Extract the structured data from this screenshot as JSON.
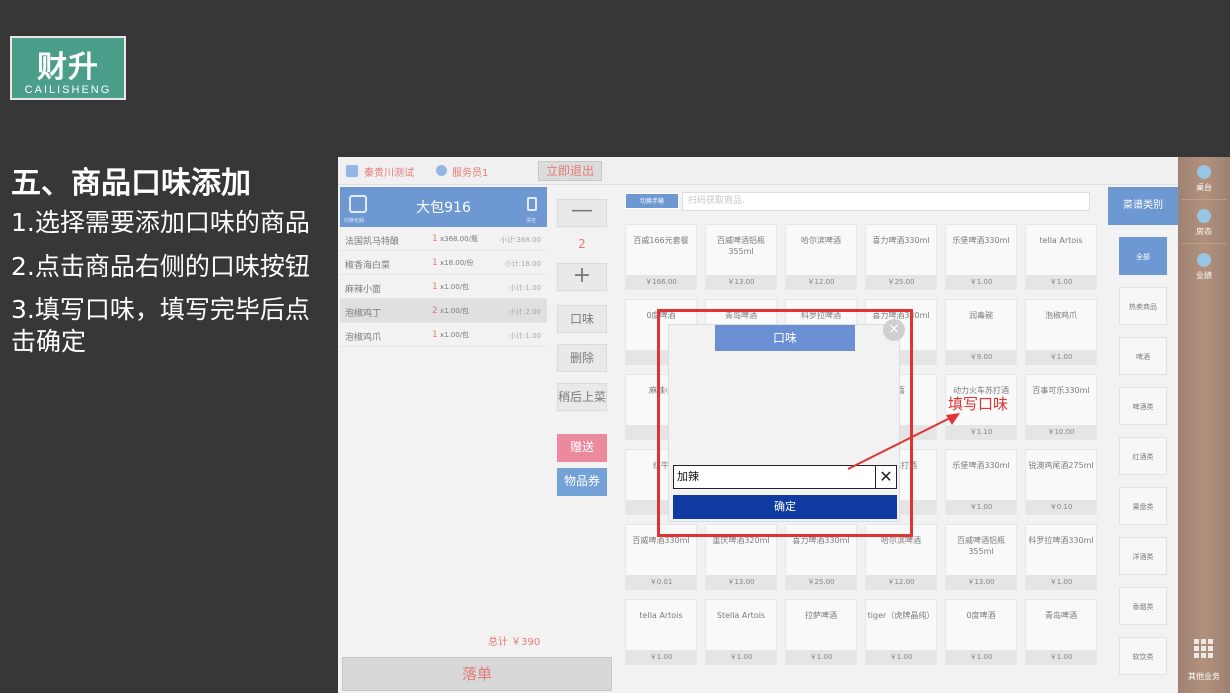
{
  "slide": {
    "logo_main": "财升",
    "logo_sub": "CAILISHENG",
    "title": "五、商品口味添加",
    "steps": [
      "1.选择需要添加口味的商品",
      "2.点击商品右侧的口味按钮",
      "3.填写口味，填写完毕后点击确定"
    ]
  },
  "pos": {
    "topbar": {
      "store": "秦贵川测试",
      "waiter": "服务员1",
      "logout": "立即退出"
    },
    "order": {
      "table": "大包916",
      "left_icon_label": "切换包厢",
      "right_icon_label": "清空",
      "items": [
        {
          "name": "法国凯马特酿",
          "qty": "1",
          "unit": "x368.00/瓶",
          "subtotal": "小计:368.00"
        },
        {
          "name": "椒香海白菜",
          "qty": "1",
          "unit": "x18.00/份",
          "subtotal": "小计:18.00"
        },
        {
          "name": "麻辣小面",
          "qty": "1",
          "unit": "x1.00/包",
          "subtotal": "小计:1.00"
        },
        {
          "name": "泡椒鸡丁",
          "qty": "2",
          "unit": "x1.00/包",
          "subtotal": "小计:2.00"
        },
        {
          "name": "泡椒鸡爪",
          "qty": "1",
          "unit": "x1.00/包",
          "subtotal": "小计:1.00"
        }
      ],
      "total": "总计 ￥390",
      "submit": "落单"
    },
    "actions": {
      "minus": "—",
      "qty": "2",
      "plus": "+",
      "taste": "口味",
      "delete": "删除",
      "later": "稍后上菜",
      "gift": "赠送",
      "voucher": "物品券"
    },
    "search": {
      "scan": "切换手输",
      "placeholder": "扫码获取商品."
    },
    "products": [
      {
        "name": "百威166元套餐",
        "price": "￥166.00"
      },
      {
        "name": "百威啤酒铝瓶355ml",
        "price": "￥13.00"
      },
      {
        "name": "哈尔滨啤酒",
        "price": "￥12.00"
      },
      {
        "name": "喜力啤酒330ml",
        "price": "￥25.00"
      },
      {
        "name": "乐堡啤酒330ml",
        "price": "￥1.00"
      },
      {
        "name": "tella Artois",
        "price": "￥1.00"
      },
      {
        "name": "0度啤酒",
        "price": ""
      },
      {
        "name": "青岛啤酒",
        "price": ""
      },
      {
        "name": "科罗拉啤酒",
        "price": ""
      },
      {
        "name": "喜力啤酒330ml",
        "price": ""
      },
      {
        "name": "润毒碗",
        "price": "￥9.00"
      },
      {
        "name": "泡椒鸡爪",
        "price": "￥1.00"
      },
      {
        "name": "麻辣小",
        "price": ""
      },
      {
        "name": "",
        "price": ""
      },
      {
        "name": "",
        "price": ""
      },
      {
        "name": "喜",
        "price": ""
      },
      {
        "name": "动力火车苏打酒",
        "price": "￥1.10"
      },
      {
        "name": "百事可乐330ml",
        "price": "￥10.00"
      },
      {
        "name": "红牛",
        "price": ""
      },
      {
        "name": "",
        "price": ""
      },
      {
        "name": "",
        "price": ""
      },
      {
        "name": "车苏打酒",
        "price": ""
      },
      {
        "name": "乐堡啤酒330ml",
        "price": "￥1.00"
      },
      {
        "name": "锐澳鸡尾酒275ml",
        "price": "￥0.10"
      },
      {
        "name": "百威啤酒330ml",
        "price": "￥0.01"
      },
      {
        "name": "重庆啤酒320ml",
        "price": "￥13.00"
      },
      {
        "name": "喜力啤酒330ml",
        "price": "￥25.00"
      },
      {
        "name": "哈尔滨啤酒",
        "price": "￥12.00"
      },
      {
        "name": "百威啤酒铝瓶355ml",
        "price": "￥13.00"
      },
      {
        "name": "科罗拉啤酒330ml",
        "price": "￥1.00"
      },
      {
        "name": "tella Artois",
        "price": "￥1.00"
      },
      {
        "name": "Stella Artois",
        "price": "￥1.00"
      },
      {
        "name": "拉萨啤酒",
        "price": "￥1.00"
      },
      {
        "name": "tiger（虎牌晶纯）",
        "price": "￥1.00"
      },
      {
        "name": "0度啤酒",
        "price": "￥1.00"
      },
      {
        "name": "青岛啤酒",
        "price": "￥1.00"
      }
    ],
    "categories": {
      "head": "菜谱类别",
      "items": [
        "全部",
        "热卖商品",
        "啤酒",
        "啤酒类",
        "红酒类",
        "果盘类",
        "洋酒类",
        "香烟类",
        "软饮类"
      ]
    },
    "sidebar": {
      "items": [
        "桌台",
        "房态",
        "业绩"
      ],
      "bottom": "其他业务"
    },
    "modal": {
      "title": "口味",
      "close": "×",
      "input_value": "加辣",
      "clear": "✕",
      "confirm": "确定"
    },
    "callout": "填写口味"
  }
}
